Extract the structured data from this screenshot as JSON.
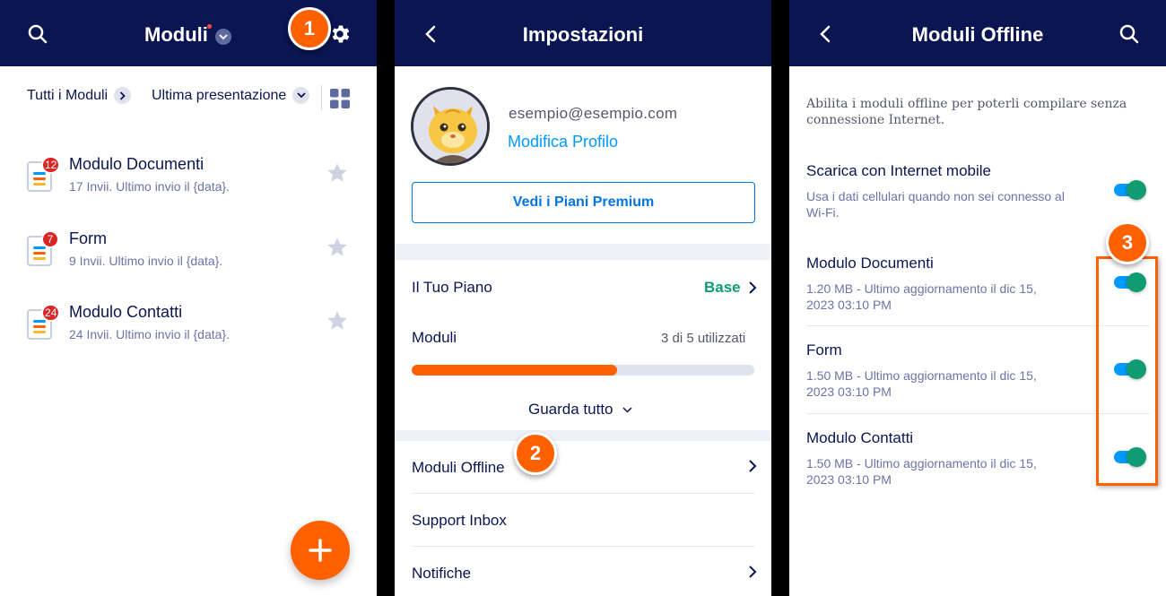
{
  "colors": {
    "header": "#0a1551",
    "accent": "#ff6100",
    "link": "#0099ff",
    "success": "#0f9c72",
    "badge": "#dc2626"
  },
  "screen1": {
    "title": "Moduli",
    "callout": "1",
    "breadcrumb": {
      "all": "Tutti i Moduli",
      "sort": "Ultima presentazione"
    },
    "forms": [
      {
        "title": "Modulo Documenti",
        "subtitle": "17 Invii. Ultimo invio il {data}.",
        "badge": "12"
      },
      {
        "title": "Form",
        "subtitle": "9 Invii. Ultimo invio il {data}.",
        "badge": "7"
      },
      {
        "title": "Modulo Contatti",
        "subtitle": "24 Invii. Ultimo invio il {data}.",
        "badge": "24"
      }
    ],
    "icons": [
      "search-icon",
      "chevron-down-icon",
      "gear-icon",
      "grid-view-icon",
      "star-icon",
      "plus-icon"
    ]
  },
  "screen2": {
    "title": "Impostazioni",
    "email": "esempio@esempio.com",
    "edit_profile": "Modifica Profilo",
    "premium_button": "Vedi i Piani Premium",
    "plan_label": "Il Tuo Piano",
    "plan_value": "Base",
    "forms_label": "Moduli",
    "forms_usage": "3 di 5 utilizzati",
    "forms_used": 3,
    "forms_limit": 5,
    "see_all": "Guarda tutto",
    "callout": "2",
    "menu": [
      {
        "label": "Moduli Offline"
      },
      {
        "label": "Support Inbox"
      },
      {
        "label": "Notifiche"
      }
    ]
  },
  "screen3": {
    "title": "Moduli Offline",
    "intro": "Abilita i moduli offline per poterli compilare senza connessione Internet.",
    "mobile_data": {
      "title": "Scarica con Internet mobile",
      "desc": "Usa i dati cellulari quando non sei connesso al Wi-Fi.",
      "enabled": true
    },
    "callout": "3",
    "forms": [
      {
        "title": "Modulo Documenti",
        "desc": "1.20 MB - Ultimo aggiornamento il dic 15, 2023 03:10 PM",
        "enabled": true
      },
      {
        "title": "Form",
        "desc": "1.50 MB - Ultimo aggiornamento il dic 15, 2023 03:10 PM",
        "enabled": true
      },
      {
        "title": "Modulo Contatti",
        "desc": "1.50 MB - Ultimo aggiornamento il dic 15, 2023 03:10 PM",
        "enabled": true
      }
    ]
  }
}
